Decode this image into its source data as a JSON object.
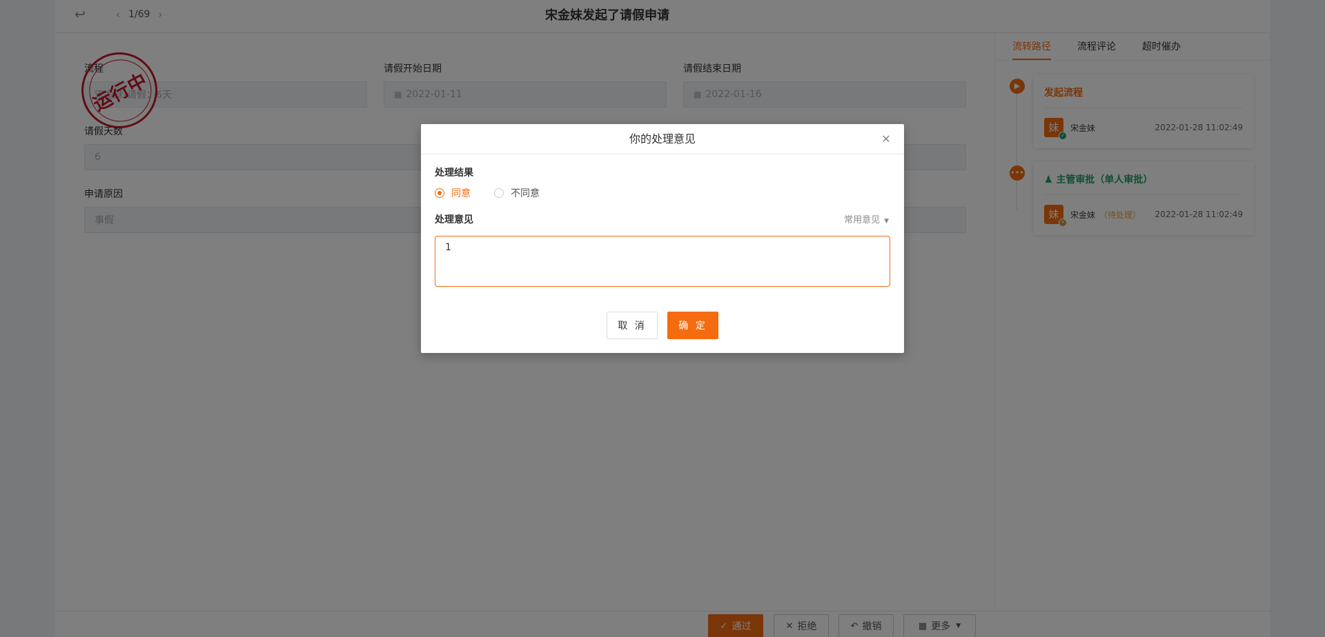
{
  "header": {
    "title": "宋金妹发起了请假申请",
    "pager": "1/69"
  },
  "stamp": {
    "text": "运行中",
    "color": "#c0182b"
  },
  "form": {
    "field1_label": "流程",
    "field1_value": "宋金妹-请假：6天",
    "start_label": "请假开始日期",
    "start_value": "2022-01-11",
    "end_label": "请假结束日期",
    "end_value": "2022-01-16",
    "days_label": "请假天数",
    "days_value": "6",
    "reason_label": "申请原因",
    "reason_value": "事假"
  },
  "right_panel": {
    "tabs": [
      {
        "label": "流转路径",
        "active": true
      },
      {
        "label": "流程评论",
        "active": false
      },
      {
        "label": "超时催办",
        "active": false
      }
    ],
    "steps": [
      {
        "title": "发起流程",
        "avatar": "妹",
        "name": "宋金妹",
        "status": "",
        "time": "2022-01-28 11:02:49"
      },
      {
        "title": "主管审批（单人审批）",
        "avatar": "妹",
        "name": "宋金妹",
        "status": "（待处理）",
        "time": "2022-01-28 11:02:49"
      }
    ]
  },
  "actions": {
    "approve": "通过",
    "reject": "拒绝",
    "revoke": "撤销",
    "more": "更多"
  },
  "modal": {
    "title": "你的处理意见",
    "result_label": "处理结果",
    "agree_label": "同意",
    "disagree_label": "不同意",
    "opinion_label": "处理意见",
    "common_opinion": "常用意见",
    "opinion_value": "1",
    "cancel_label": "取 消",
    "ok_label": "确 定"
  },
  "colors": {
    "accent": "#f56c10",
    "success": "#20a060"
  }
}
